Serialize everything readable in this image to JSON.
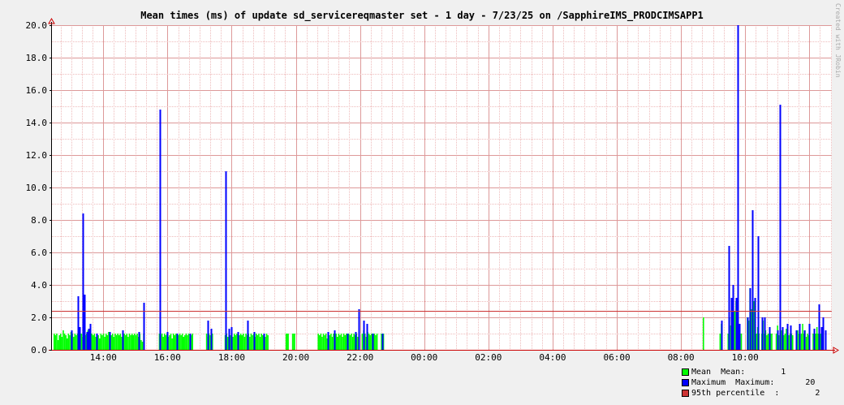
{
  "chart_data": {
    "type": "area",
    "title": "Mean times (ms) of update sd_servicereqmaster set - 1 day - 7/23/25 on /SapphireIMS_PRODCIMSAPP1",
    "watermark": "Created with JRobin",
    "xlabel": "",
    "ylabel": "",
    "ylim": [
      0,
      20
    ],
    "y_ticks": [
      "0.0",
      "2.0",
      "4.0",
      "6.0",
      "8.0",
      "10.0",
      "12.0",
      "14.0",
      "16.0",
      "18.0",
      "20.0"
    ],
    "x_ticks": [
      "14:00",
      "16:00",
      "18:00",
      "20:00",
      "22:00",
      "00:00",
      "02:00",
      "04:00",
      "06:00",
      "08:00",
      "10:00"
    ],
    "x_range_hours": [
      12.4,
      36.7
    ],
    "x_tick_hours": [
      14,
      16,
      18,
      20,
      22,
      24,
      26,
      28,
      30,
      32,
      34
    ],
    "grid": true,
    "legend_placement": "bottom-right",
    "colors": {
      "mean": "#00ff00",
      "maximum": "#0000ff",
      "percentile": "#cc3333",
      "grid_minor": "#eebbbb",
      "grid_major": "#dd9999"
    },
    "percentile_95": 2.42,
    "mean_segments": [
      {
        "start": 12.45,
        "end": 15.28,
        "values": [
          1.0,
          0.9,
          1.0,
          0.6,
          0.9,
          1.0,
          0.8,
          1.2,
          1.0,
          0.9,
          0.7,
          1.0,
          0.9,
          1.1,
          1.0,
          0.8,
          1.0,
          0.9,
          1.0,
          1.1,
          0.9,
          1.0,
          0.8,
          1.0,
          0.9,
          1.0,
          1.2,
          0.9,
          0.8,
          1.0,
          0.9,
          1.0,
          0.8,
          1.0,
          0.9,
          0.7,
          1.0,
          0.9,
          1.0,
          0.8,
          1.0,
          0.9,
          1.1,
          1.0,
          0.9,
          1.0,
          0.8,
          1.0,
          0.9,
          1.0,
          0.9,
          1.0,
          0.8,
          0.9,
          1.0,
          0.9,
          1.0,
          0.8,
          1.0,
          0.9,
          1.0,
          0.9,
          1.0,
          0.9,
          1.0,
          0.8,
          1.0,
          0.6,
          0.5,
          1.0
        ]
      },
      {
        "start": 15.73,
        "end": 16.8,
        "values": [
          1.0,
          0.9,
          1.0,
          0.8,
          1.0,
          0.9,
          1.0,
          0.8,
          0.9,
          1.0,
          0.7,
          1.0,
          0.9,
          1.0,
          0.8,
          0.9,
          1.0,
          0.9,
          1.0,
          0.8,
          0.9,
          1.0,
          0.9,
          1.0,
          0.8,
          0.9,
          1.0
        ]
      },
      {
        "start": 17.2,
        "end": 17.42,
        "values": [
          1.0,
          0.8,
          1.0,
          0.9,
          0.7,
          1.0
        ]
      },
      {
        "start": 17.78,
        "end": 19.15,
        "values": [
          0.9,
          1.0,
          0.8,
          1.0,
          0.9,
          1.0,
          0.8,
          1.0,
          0.9,
          1.0,
          0.8,
          0.9,
          1.0,
          0.9,
          1.0,
          0.8,
          1.0,
          0.9,
          1.0,
          0.8,
          1.0,
          0.9,
          1.0,
          0.8,
          1.0,
          0.9,
          1.0,
          0.8,
          1.0,
          0.9,
          1.0,
          0.8,
          1.0,
          0.9
        ]
      },
      {
        "start": 19.68,
        "end": 19.78,
        "values": [
          1.0,
          1.0
        ]
      },
      {
        "start": 19.88,
        "end": 19.98,
        "values": [
          1.0,
          1.0
        ]
      },
      {
        "start": 20.68,
        "end": 21.95,
        "values": [
          1.0,
          0.9,
          1.0,
          0.8,
          1.0,
          0.9,
          1.0,
          0.7,
          1.0,
          0.9,
          1.0,
          0.8,
          1.0,
          0.9,
          1.0,
          0.8,
          1.0,
          0.9,
          1.0,
          0.8,
          1.0,
          0.9,
          1.0,
          0.8,
          1.0,
          0.9,
          1.0,
          0.8,
          1.0,
          0.9,
          1.0,
          0.8
        ]
      },
      {
        "start": 22.05,
        "end": 22.55,
        "values": [
          1.0,
          1.2,
          1.0,
          0.8,
          1.1,
          1.0,
          0.9,
          1.0,
          0.8,
          1.0,
          0.9,
          1.0
        ]
      },
      {
        "start": 22.65,
        "end": 22.75,
        "values": [
          1.0,
          0.9,
          1.0
        ]
      },
      {
        "start": 32.68,
        "end": 32.72,
        "values": [
          2.0
        ]
      },
      {
        "start": 33.2,
        "end": 33.28,
        "values": [
          1.0,
          1.6
        ]
      },
      {
        "start": 33.45,
        "end": 33.9,
        "values": [
          1.0,
          2.0,
          1.5,
          1.0,
          1.8,
          2.4,
          3.0,
          1.2,
          1.0,
          0.8,
          1.0
        ]
      },
      {
        "start": 34.05,
        "end": 34.45,
        "values": [
          2.0,
          1.8,
          3.8,
          2.5,
          2.0,
          3.0,
          2.0,
          1.0,
          1.4,
          1.0
        ]
      },
      {
        "start": 34.5,
        "end": 34.85,
        "values": [
          1.0,
          1.8,
          1.0,
          1.2,
          0.9,
          1.0,
          1.0,
          1.0,
          1.0
        ]
      },
      {
        "start": 34.95,
        "end": 35.5,
        "values": [
          1.0,
          1.5,
          0.9,
          1.0,
          1.2,
          1.0,
          0.9,
          1.0,
          1.3,
          1.0,
          0.9,
          1.0,
          1.0,
          0.9
        ]
      },
      {
        "start": 35.58,
        "end": 36.0,
        "values": [
          1.0,
          1.2,
          1.0,
          0.9,
          1.0,
          1.6,
          1.0,
          1.2,
          0.8,
          1.0,
          0.9
        ]
      },
      {
        "start": 36.1,
        "end": 36.45,
        "values": [
          1.0,
          0.9,
          1.0,
          1.4,
          1.0,
          0.8,
          1.0,
          1.0,
          1.0
        ]
      }
    ],
    "maximum_spikes": [
      [
        13.0,
        1.2
      ],
      [
        13.22,
        3.3
      ],
      [
        13.27,
        1.4
      ],
      [
        13.35,
        8.4
      ],
      [
        13.4,
        3.4
      ],
      [
        13.55,
        1.3
      ],
      [
        13.6,
        1.6
      ],
      [
        13.48,
        1.1
      ],
      [
        13.8,
        1.0
      ],
      [
        14.2,
        1.1
      ],
      [
        14.6,
        1.2
      ],
      [
        15.1,
        1.1
      ],
      [
        15.25,
        2.9
      ],
      [
        15.77,
        14.8
      ],
      [
        16.0,
        1.1
      ],
      [
        16.3,
        1.0
      ],
      [
        16.7,
        1.0
      ],
      [
        17.25,
        1.8
      ],
      [
        17.35,
        1.3
      ],
      [
        17.8,
        11.0
      ],
      [
        17.9,
        1.3
      ],
      [
        18.0,
        1.4
      ],
      [
        18.2,
        1.1
      ],
      [
        18.5,
        1.8
      ],
      [
        18.7,
        1.1
      ],
      [
        19.0,
        1.0
      ],
      [
        21.0,
        1.1
      ],
      [
        21.2,
        1.2
      ],
      [
        21.6,
        1.0
      ],
      [
        21.85,
        1.1
      ],
      [
        21.97,
        2.5
      ],
      [
        22.1,
        1.8
      ],
      [
        22.2,
        1.6
      ],
      [
        22.4,
        1.0
      ],
      [
        22.7,
        1.0
      ],
      [
        33.25,
        1.8
      ],
      [
        33.5,
        6.4
      ],
      [
        33.56,
        3.2
      ],
      [
        33.62,
        4.0
      ],
      [
        33.72,
        3.2
      ],
      [
        33.76,
        20.0
      ],
      [
        33.82,
        1.6
      ],
      [
        34.08,
        2.0
      ],
      [
        34.15,
        3.8
      ],
      [
        34.22,
        8.6
      ],
      [
        34.3,
        3.2
      ],
      [
        34.4,
        7.0
      ],
      [
        34.52,
        2.0
      ],
      [
        34.6,
        2.0
      ],
      [
        34.75,
        1.4
      ],
      [
        35.0,
        1.2
      ],
      [
        35.08,
        15.1
      ],
      [
        35.15,
        1.4
      ],
      [
        35.3,
        1.6
      ],
      [
        35.4,
        1.5
      ],
      [
        35.6,
        1.2
      ],
      [
        35.7,
        1.6
      ],
      [
        35.85,
        1.2
      ],
      [
        36.0,
        1.6
      ],
      [
        36.15,
        1.3
      ],
      [
        36.3,
        2.8
      ],
      [
        36.36,
        1.4
      ],
      [
        36.42,
        2.0
      ],
      [
        36.5,
        1.2
      ]
    ],
    "legend": [
      {
        "name": "Mean",
        "label": "Mean  Mean:",
        "value": "1",
        "color": "#00ff00"
      },
      {
        "name": "Maximum",
        "label": "Maximum  Maximum:",
        "value": "20",
        "color": "#0000ff"
      },
      {
        "name": "95th percentile",
        "label": "95th percentile  :",
        "value": "2",
        "color": "#cc3333"
      }
    ]
  }
}
